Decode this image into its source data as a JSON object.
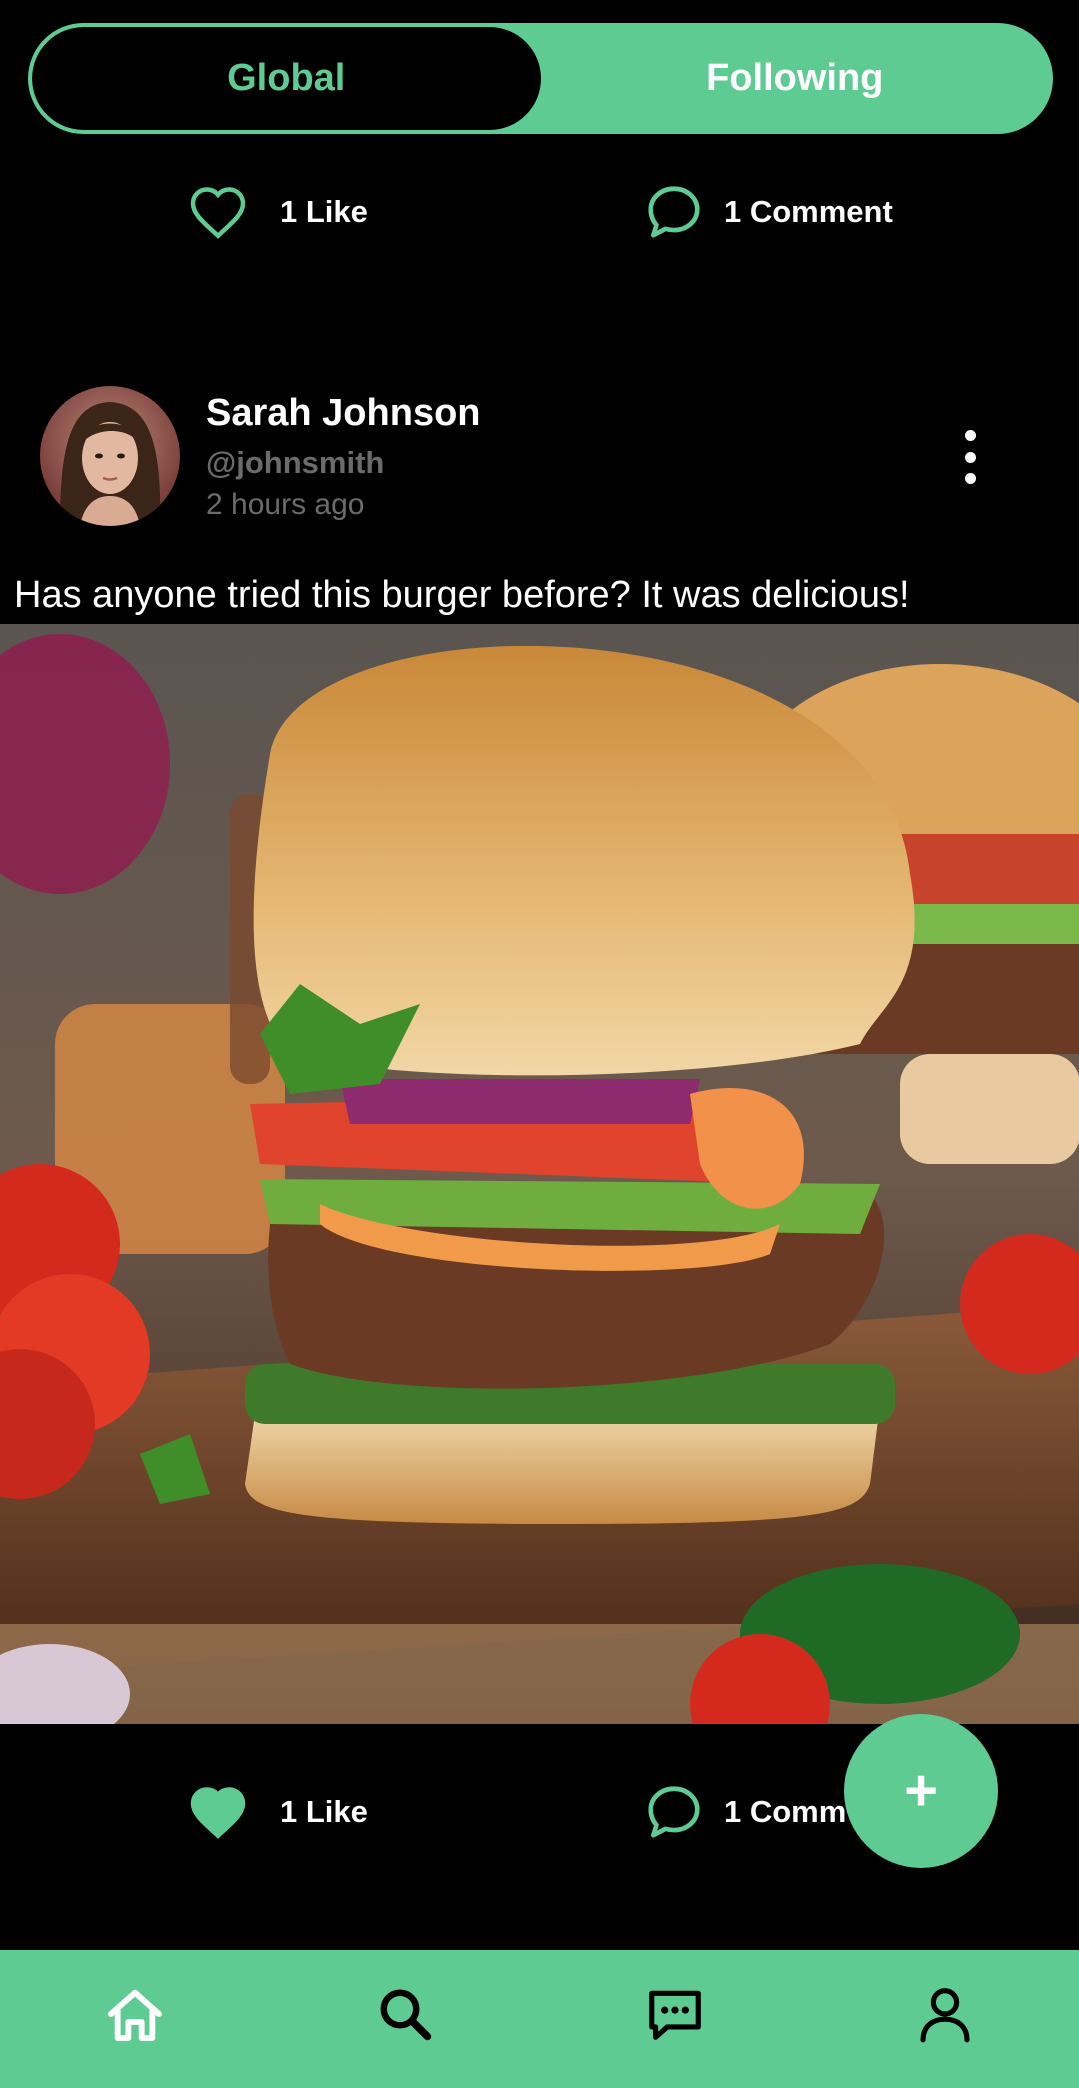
{
  "tabs": {
    "global": "Global",
    "following": "Following"
  },
  "top_actions": {
    "like_label": "1 Like",
    "comment_label": "1 Comment"
  },
  "post": {
    "author_name": "Sarah Johnson",
    "author_handle": "@johnsmith",
    "timestamp": "2 hours ago",
    "caption": "Has anyone tried this burger before? It was delicious!",
    "like_label": "1 Like",
    "comment_label": "1 Comm"
  },
  "fab": {
    "label": "+"
  },
  "nav": {
    "items": [
      {
        "icon": "home-icon"
      },
      {
        "icon": "search-icon"
      },
      {
        "icon": "chat-icon"
      },
      {
        "icon": "profile-icon"
      }
    ]
  },
  "colors": {
    "accent": "#5ecc92",
    "background": "#000000",
    "muted_text": "#6b6b6b"
  }
}
